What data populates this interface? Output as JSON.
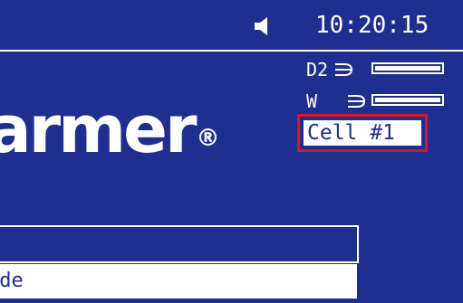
{
  "status_bar": {
    "time": "10:20:15",
    "speaker_icon": "speaker-icon"
  },
  "lamps": [
    {
      "label": "D2",
      "icon": "lamp-rays-icon",
      "level": 1.0
    },
    {
      "label": "W",
      "icon": "lamp-rays-icon",
      "level": 1.0
    }
  ],
  "cell": {
    "label": "Cell #1"
  },
  "logo": {
    "text": "armer",
    "mark": "®"
  },
  "menu": {
    "field_text": "ode"
  },
  "colors": {
    "background": "#1f2f8f",
    "foreground": "#ffffff",
    "highlight": "#e0141e"
  }
}
